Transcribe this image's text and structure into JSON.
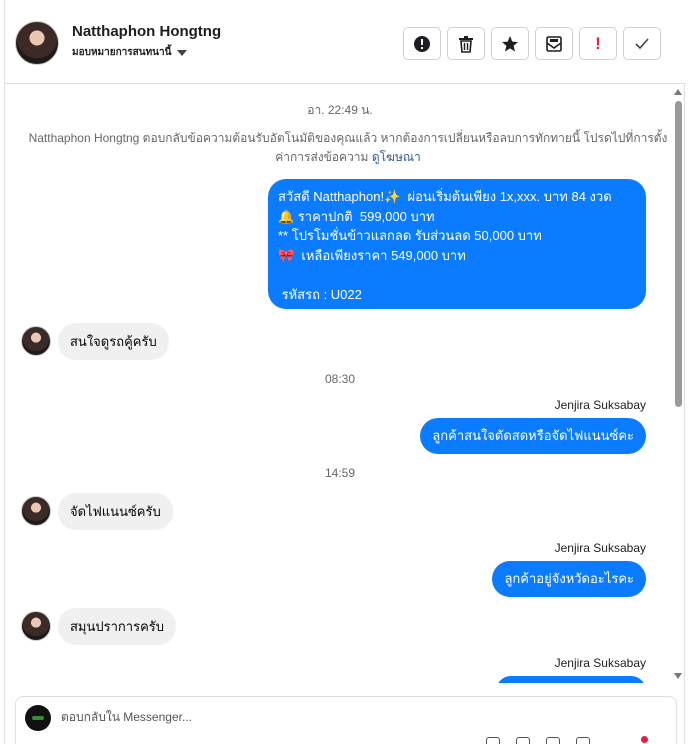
{
  "header": {
    "name": "Natthaphon Hongtng",
    "assign_label": "มอบหมายการสนทนานี้"
  },
  "toolbar": {
    "buttons": [
      {
        "icon": "alert-circle-icon"
      },
      {
        "icon": "trash-icon"
      },
      {
        "icon": "star-icon"
      },
      {
        "icon": "mark-unread-icon"
      },
      {
        "icon": "spam-icon",
        "label": "!"
      },
      {
        "icon": "check-icon"
      }
    ]
  },
  "thread": {
    "timestamp_1": "อา. 22:49 น.",
    "system_note": "Natthaphon Hongtng ตอบกลับข้อความต้อนรับอัตโนมัติของคุณแล้ว หากต้องการเปลี่ยนหรือลบการทักทายนี้ โปรดไปที่การตั้งค่าการส่งข้อความ",
    "system_link": "ดูโฆษณา",
    "promo": {
      "line1": "สวัสดี Natthaphon!✨  ผ่อนเริ่มต้นเพียง 1x,xxx. บาท 84 งวด",
      "line2": "🔔 ราคาปกติ  599,000 บาท",
      "line3": "** โปรโมชั่นข้าวแลกลด รับส่วนลด 50,000 บาท",
      "line4": "🎀  เหลือเพียงราคา 549,000 บาท",
      "line5": "",
      "line6": " รหัสรถ : U022"
    },
    "msg_in_1": "สนใจดูรถคู้ครับ",
    "timestamp_2": "08:30",
    "sender_1": "Jenjira Suksabay",
    "msg_out_1": "ลูกค้าสนใจตัดสดหรือจัดไฟแนนซ์คะ",
    "timestamp_3": "14:59",
    "msg_in_2": "จัดไฟแนนซ์ครับ",
    "sender_2": "Jenjira Suksabay",
    "msg_out_2": "ลูกค้าอยู่จังหวัดอะไรคะ",
    "msg_in_3": "สมุนปราการครับ",
    "sender_3": "Jenjira Suksabay"
  },
  "composer": {
    "placeholder": "ตอบกลับใน Messenger..."
  }
}
